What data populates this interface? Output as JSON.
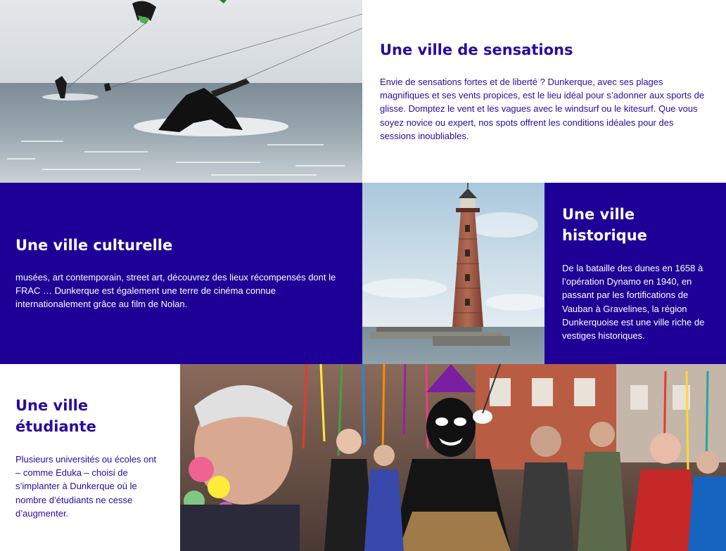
{
  "sections": {
    "sensations": {
      "title": "Une ville de sensations",
      "body": "Envie de sensations fortes et de liberté ? Dunkerque, avec ses plages magnifiques et ses vents propices, est le lieu idéal pour s’adonner aux sports de glisse. Domptez le vent et les vagues avec le windsurf ou le kitesurf. Que vous soyez novice ou expert, nos spots offrent les conditions idéales pour des sessions inoubliables."
    },
    "culture": {
      "title": "Une ville culturelle",
      "body": "musées, art contemporain, street art, découvrez des lieux récompensés dont le FRAC … Dunkerque est également une terre de cinéma connue internationalement grâce au film de Nolan."
    },
    "history": {
      "title": "Une ville historique",
      "body": "De la bataille des dunes en 1658 à l’opération Dynamo en 1940, en passant par les fortifications de Vauban à Gravelines, la région Dunkerquoise est une ville riche de vestiges historiques."
    },
    "student": {
      "title": "Une ville étudiante",
      "body": "Plusieurs universités ou écoles ont – comme Eduka – choisi de s’implanter à Dunkerque où le nombre d’étudiants ne cesse d’augmenter."
    }
  },
  "colors": {
    "accent_dark": "#1f0096",
    "title_light": "#2a0a9e"
  }
}
